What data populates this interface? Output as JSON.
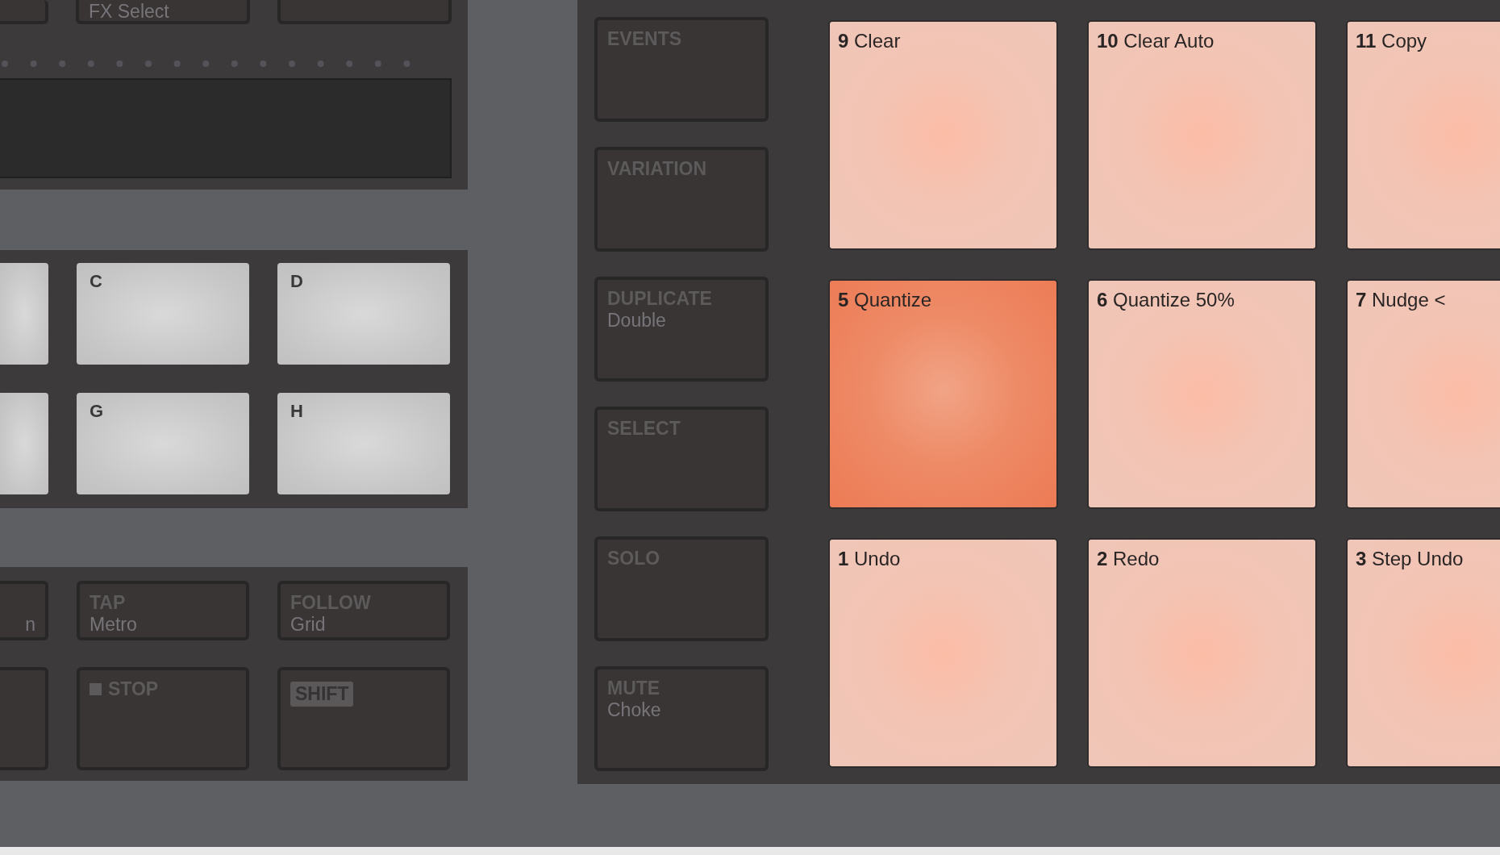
{
  "left_section": {
    "top_buttons": [
      {
        "kind": "partial"
      },
      {
        "kind": "labeled",
        "label": "FX Select"
      },
      {
        "kind": "blank"
      }
    ],
    "group_pads": [
      {
        "kind": "partial"
      },
      {
        "kind": "pad",
        "label": "C"
      },
      {
        "kind": "pad",
        "label": "D"
      },
      {
        "kind": "partial"
      },
      {
        "kind": "pad",
        "label": "G"
      },
      {
        "kind": "pad",
        "label": "H"
      }
    ],
    "transport_buttons": [
      {
        "kind": "partial",
        "sublabel": "n"
      },
      {
        "kind": "button",
        "label": "TAP",
        "sublabel": "Metro"
      },
      {
        "kind": "button",
        "label": "FOLLOW",
        "sublabel": "Grid"
      },
      {
        "kind": "partial"
      },
      {
        "kind": "stop",
        "label": "STOP"
      },
      {
        "kind": "shift",
        "label": "SHIFT"
      }
    ]
  },
  "right_section": {
    "mode_buttons": [
      {
        "label": "EVENTS"
      },
      {
        "label": "VARIATION"
      },
      {
        "label": "DUPLICATE",
        "sublabel": "Double"
      },
      {
        "label": "SELECT"
      },
      {
        "label": "SOLO"
      },
      {
        "label": "MUTE",
        "sublabel": "Choke"
      }
    ],
    "pads": [
      {
        "label": "**9** Clear",
        "selected": false
      },
      {
        "label": "**10** Clear Auto",
        "selected": false
      },
      {
        "label": "**11** Copy",
        "selected": false
      },
      {
        "label": "**5** Quantize",
        "selected": true
      },
      {
        "label": "**6** Quantize 50%",
        "selected": false
      },
      {
        "label": "**7** Nudge <",
        "selected": false
      },
      {
        "label": "**1** Undo",
        "selected": false
      },
      {
        "label": "**2** Redo",
        "selected": false
      },
      {
        "label": "**3** Step Undo",
        "selected": false
      }
    ]
  }
}
